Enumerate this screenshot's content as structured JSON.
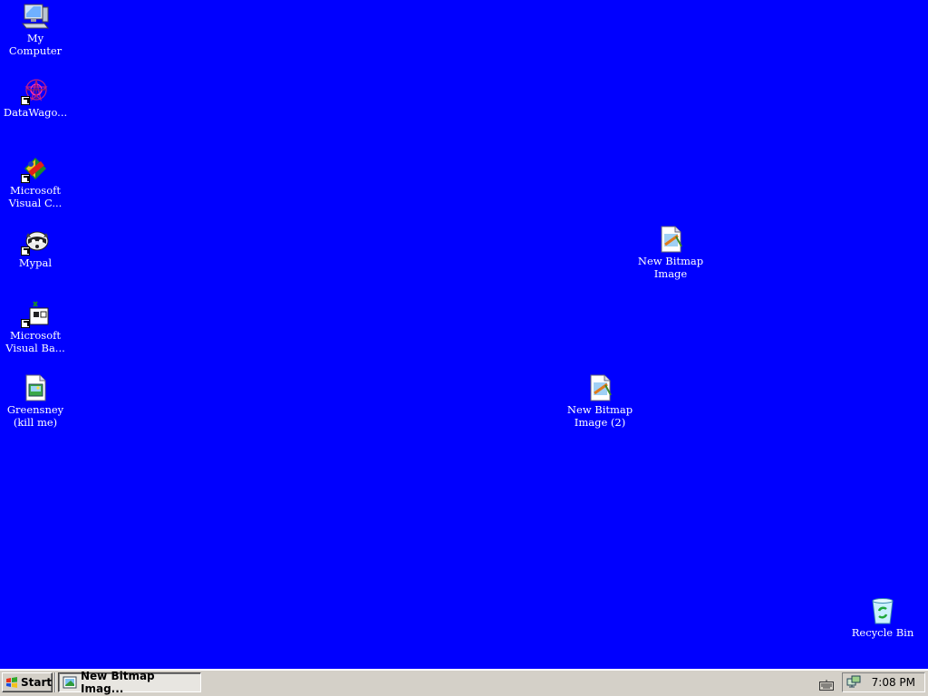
{
  "desktop": {
    "background": "#0000ff",
    "icons": [
      {
        "label": "My\nComputer",
        "icon": "my-computer-icon",
        "shortcut": false
      },
      {
        "label": "DataWago...",
        "icon": "datawagon-icon",
        "shortcut": true
      },
      {
        "label": "Microsoft\nVisual C...",
        "icon": "visual-c-icon",
        "shortcut": true
      },
      {
        "label": "Mypal",
        "icon": "mypal-icon",
        "shortcut": true
      },
      {
        "label": "Microsoft\nVisual Ba...",
        "icon": "visual-basic-icon",
        "shortcut": true
      },
      {
        "label": "Greensney\n(kill me)",
        "icon": "image-file-icon",
        "shortcut": false
      },
      {
        "label": "New Bitmap\nImage",
        "icon": "bitmap-file-icon",
        "shortcut": false
      },
      {
        "label": "New Bitmap\nImage (2)",
        "icon": "bitmap-file-icon",
        "shortcut": false
      },
      {
        "label": "Recycle Bin",
        "icon": "recycle-bin-icon",
        "shortcut": false
      }
    ]
  },
  "taskbar": {
    "start_label": "Start",
    "task_label": "New Bitmap Imag...",
    "clock": "7:08 PM"
  }
}
